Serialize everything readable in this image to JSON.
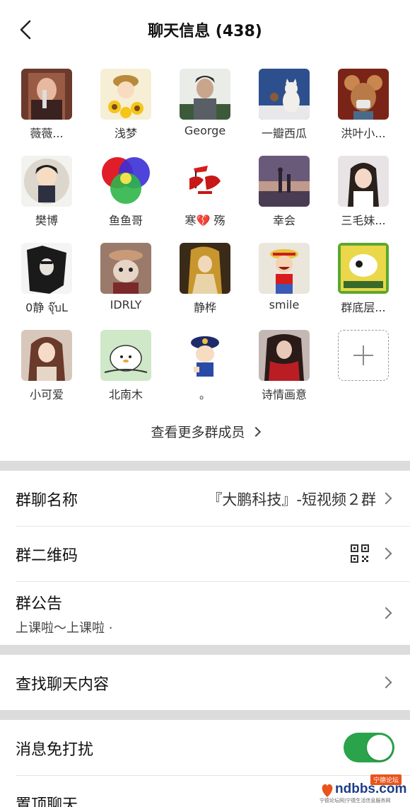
{
  "header": {
    "title": "聊天信息 (438)"
  },
  "members": [
    {
      "name": "薇薇...",
      "icon": "portrait-photo-icon"
    },
    {
      "name": "浅梦",
      "icon": "sunflower-girl-icon"
    },
    {
      "name": "George",
      "icon": "man-portrait-icon"
    },
    {
      "name": "一瓣西瓜",
      "icon": "cat-icon"
    },
    {
      "name": "洪叶小...",
      "icon": "mouse-cartoon-icon"
    },
    {
      "name": "樊博",
      "icon": "chibi-warrior-icon"
    },
    {
      "name": "鱼鱼哥",
      "icon": "color-circles-icon"
    },
    {
      "name": "寒💔 殇",
      "icon": "red-calligraphy-icon"
    },
    {
      "name": "幸会",
      "icon": "sunset-silhouette-icon"
    },
    {
      "name": "三毛妹...",
      "icon": "girl-selfie-icon"
    },
    {
      "name": "0静 จุ๊บL",
      "icon": "dark-anime-icon"
    },
    {
      "name": "IDRLY",
      "icon": "cat-in-hat-icon"
    },
    {
      "name": "静桦",
      "icon": "fairy-painting-icon"
    },
    {
      "name": "smile",
      "icon": "luffy-icon"
    },
    {
      "name": "群底层...",
      "icon": "aries-cartoon-icon"
    },
    {
      "name": "小可爱",
      "icon": "girl-portrait-icon"
    },
    {
      "name": "北南木",
      "icon": "cartoon-chick-icon"
    },
    {
      "name": "。",
      "icon": "cartoon-boy-icon"
    },
    {
      "name": "诗情画意",
      "icon": "woman-red-scarf-icon"
    }
  ],
  "more_members_label": "查看更多群成员",
  "settings": {
    "group_name": {
      "label": "群聊名称",
      "value": "『大鹏科技』-短视频２群"
    },
    "qr_code": {
      "label": "群二维码"
    },
    "notice": {
      "label": "群公告",
      "preview": "上课啦～上课啦 ·"
    },
    "search": {
      "label": "查找聊天内容"
    },
    "mute": {
      "label": "消息免打扰",
      "enabled": true
    },
    "pin": {
      "label": "置顶聊天"
    }
  },
  "watermark": {
    "text": "ndbbs.com",
    "badge": "宁德论坛",
    "sub": "宁德论坛网|宁德生活信息服务网"
  },
  "colors": {
    "toggle_on": "#2aa34a",
    "separator": "#dcdcdc"
  }
}
